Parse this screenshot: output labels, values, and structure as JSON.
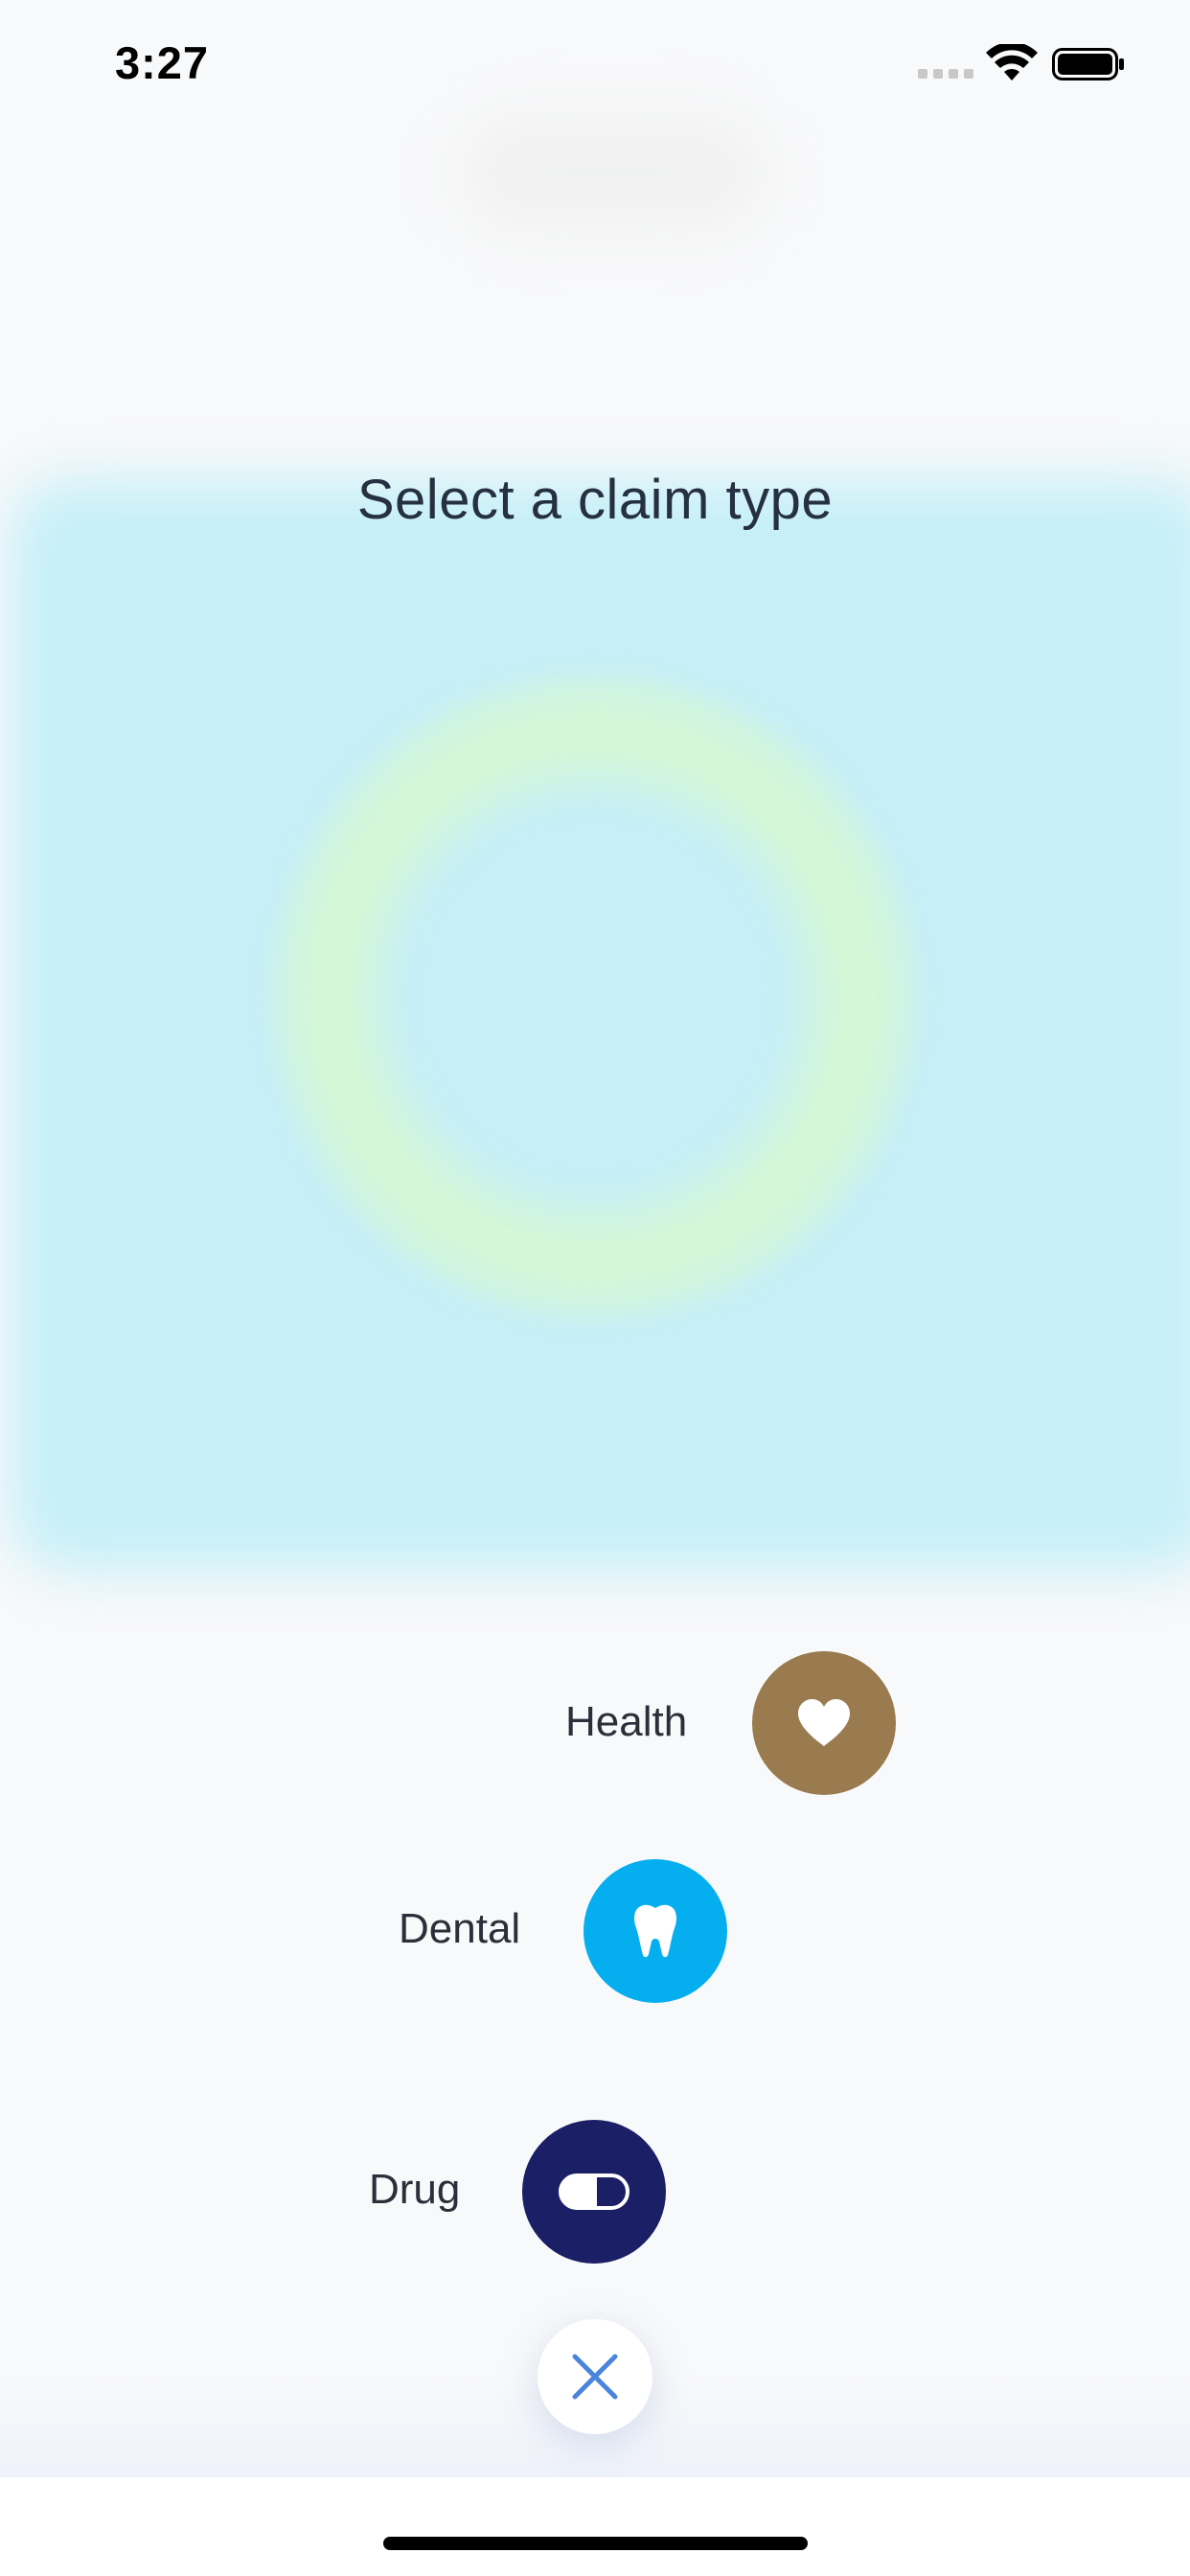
{
  "status_bar": {
    "time": "3:27"
  },
  "title": "Select a claim type",
  "options": [
    {
      "label": "Health",
      "icon": "heart-icon",
      "color": "#9a7b4f"
    },
    {
      "label": "Dental",
      "icon": "tooth-icon",
      "color": "#04aeef"
    },
    {
      "label": "Drug",
      "icon": "pill-icon",
      "color": "#1a1f66"
    }
  ],
  "close": {
    "icon": "close-icon",
    "color": "#4a84dd"
  }
}
